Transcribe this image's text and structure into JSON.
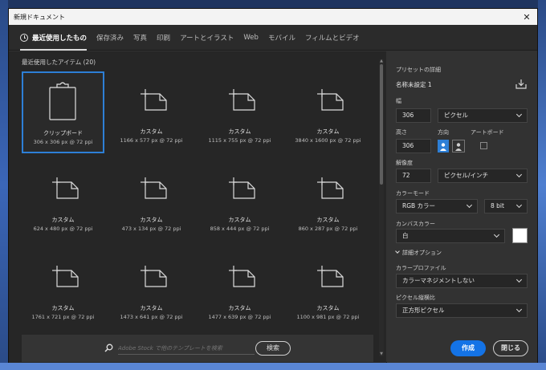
{
  "window": {
    "title": "新規ドキュメント"
  },
  "tabs": [
    {
      "label": "最近使用したもの",
      "active": true
    },
    {
      "label": "保存済み"
    },
    {
      "label": "写真"
    },
    {
      "label": "印刷"
    },
    {
      "label": "アートとイラスト"
    },
    {
      "label": "Web"
    },
    {
      "label": "モバイル"
    },
    {
      "label": "フィルムとビデオ"
    }
  ],
  "recent": {
    "title": "最近使用したアイテム (20)",
    "items": [
      {
        "name": "クリップボード",
        "size": "306 x 306 px @ 72 ppi",
        "icon": "clipboard-icon",
        "selected": true
      },
      {
        "name": "カスタム",
        "size": "1166 x 577 px @ 72 ppi",
        "icon": "document-icon"
      },
      {
        "name": "カスタム",
        "size": "1115 x 755 px @ 72 ppi",
        "icon": "document-icon"
      },
      {
        "name": "カスタム",
        "size": "3840 x 1600 px @ 72 ppi",
        "icon": "document-icon"
      },
      {
        "name": "カスタム",
        "size": "624 x 480 px @ 72 ppi",
        "icon": "document-icon"
      },
      {
        "name": "カスタム",
        "size": "473 x 134 px @ 72 ppi",
        "icon": "document-icon"
      },
      {
        "name": "カスタム",
        "size": "858 x 444 px @ 72 ppi",
        "icon": "document-icon"
      },
      {
        "name": "カスタム",
        "size": "860 x 287 px @ 72 ppi",
        "icon": "document-icon"
      },
      {
        "name": "カスタム",
        "size": "1761 x 721 px @ 72 ppi",
        "icon": "document-icon"
      },
      {
        "name": "カスタム",
        "size": "1473 x 641 px @ 72 ppi",
        "icon": "document-icon"
      },
      {
        "name": "カスタム",
        "size": "1477 x 639 px @ 72 ppi",
        "icon": "document-icon"
      },
      {
        "name": "カスタム",
        "size": "1100 x 981 px @ 72 ppi",
        "icon": "document-icon"
      }
    ]
  },
  "search": {
    "placeholder": "Adobe Stock で他のテンプレートを検索",
    "button": "検索"
  },
  "preset": {
    "section_title": "プリセットの詳細",
    "name": "名称未設定 1",
    "width_label": "幅",
    "width_value": "306",
    "width_unit": "ピクセル",
    "height_label": "高さ",
    "height_value": "306",
    "orientation_label": "方向",
    "artboard_label": "アートボード",
    "resolution_label": "解像度",
    "resolution_value": "72",
    "resolution_unit": "ピクセル/インチ",
    "color_mode_label": "カラーモード",
    "color_mode": "RGB カラー",
    "bit_depth": "8 bit",
    "canvas_color_label": "カンバスカラー",
    "canvas_color": "白",
    "advanced_label": "詳細オプション",
    "color_profile_label": "カラープロファイル",
    "color_profile": "カラーマネジメントしない",
    "pixel_aspect_label": "ピクセル縦横比",
    "pixel_aspect": "正方形ピクセル"
  },
  "actions": {
    "create": "作成",
    "close": "閉じる"
  },
  "colors": {
    "accent": "#1473e6",
    "selection": "#2d7fd6",
    "canvas_swatch": "#ffffff"
  }
}
